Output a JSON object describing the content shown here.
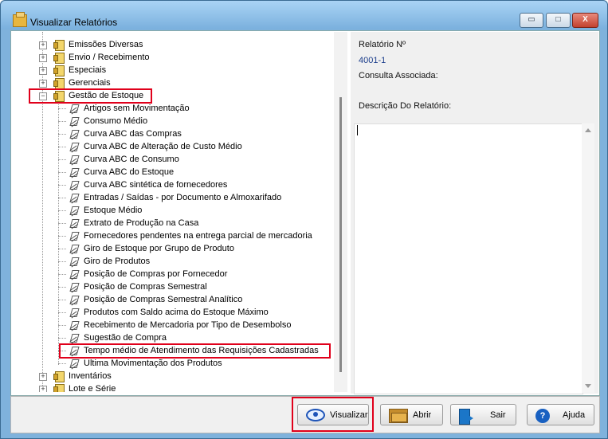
{
  "window": {
    "title": "Visualizar Relatórios"
  },
  "tree": {
    "items": [
      {
        "label": "Emissões Diversas",
        "type": "folder",
        "expander": "+"
      },
      {
        "label": "Envio / Recebimento",
        "type": "folder",
        "expander": "+"
      },
      {
        "label": "Especiais",
        "type": "folder",
        "expander": "+"
      },
      {
        "label": "Gerenciais",
        "type": "folder",
        "expander": "+"
      },
      {
        "label": "Gestão de Estoque",
        "type": "folder",
        "expander": "−"
      },
      {
        "label": "Artigos sem Movimentação",
        "type": "report"
      },
      {
        "label": "Consumo Médio",
        "type": "report"
      },
      {
        "label": "Curva ABC das Compras",
        "type": "report"
      },
      {
        "label": "Curva ABC de Alteração de Custo Médio",
        "type": "report"
      },
      {
        "label": "Curva ABC de Consumo",
        "type": "report"
      },
      {
        "label": "Curva ABC do Estoque",
        "type": "report"
      },
      {
        "label": "Curva ABC sintética de fornecedores",
        "type": "report"
      },
      {
        "label": "Entradas / Saídas - por Documento e Almoxarifado",
        "type": "report"
      },
      {
        "label": "Estoque Médio",
        "type": "report"
      },
      {
        "label": "Extrato de Produção na Casa",
        "type": "report"
      },
      {
        "label": "Fornecedores pendentes na entrega parcial de mercadoria",
        "type": "report"
      },
      {
        "label": "Giro de Estoque por Grupo de Produto",
        "type": "report"
      },
      {
        "label": "Giro de Produtos",
        "type": "report"
      },
      {
        "label": "Posição de Compras por Fornecedor",
        "type": "report"
      },
      {
        "label": "Posição de Compras Semestral",
        "type": "report"
      },
      {
        "label": "Posição de Compras Semestral Analítico",
        "type": "report"
      },
      {
        "label": "Produtos com Saldo acima do Estoque Máximo",
        "type": "report"
      },
      {
        "label": "Recebimento de Mercadoria por Tipo de Desembolso",
        "type": "report"
      },
      {
        "label": "Sugestão de Compra",
        "type": "report"
      },
      {
        "label": "Tempo médio de Atendimento das Requisições Cadastradas",
        "type": "report"
      },
      {
        "label": "Ultima Movimentação dos Produtos",
        "type": "report"
      },
      {
        "label": "Inventários",
        "type": "folder",
        "expander": "+"
      },
      {
        "label": "Lote e Série",
        "type": "folder",
        "expander": "+"
      }
    ]
  },
  "details": {
    "report_label": "Relatório Nº",
    "report_number": "4001-1",
    "query_label": "Consulta Associada:",
    "description_label": "Descrição Do Relatório:"
  },
  "buttons": {
    "view": "Visualizar",
    "open": "Abrir",
    "exit": "Sair",
    "help": "Ajuda"
  },
  "window_controls": {
    "minimize": "▭",
    "maximize": "□",
    "close": "X"
  },
  "colors": {
    "highlight": "#e0001b",
    "accent": "#1e54b8"
  }
}
